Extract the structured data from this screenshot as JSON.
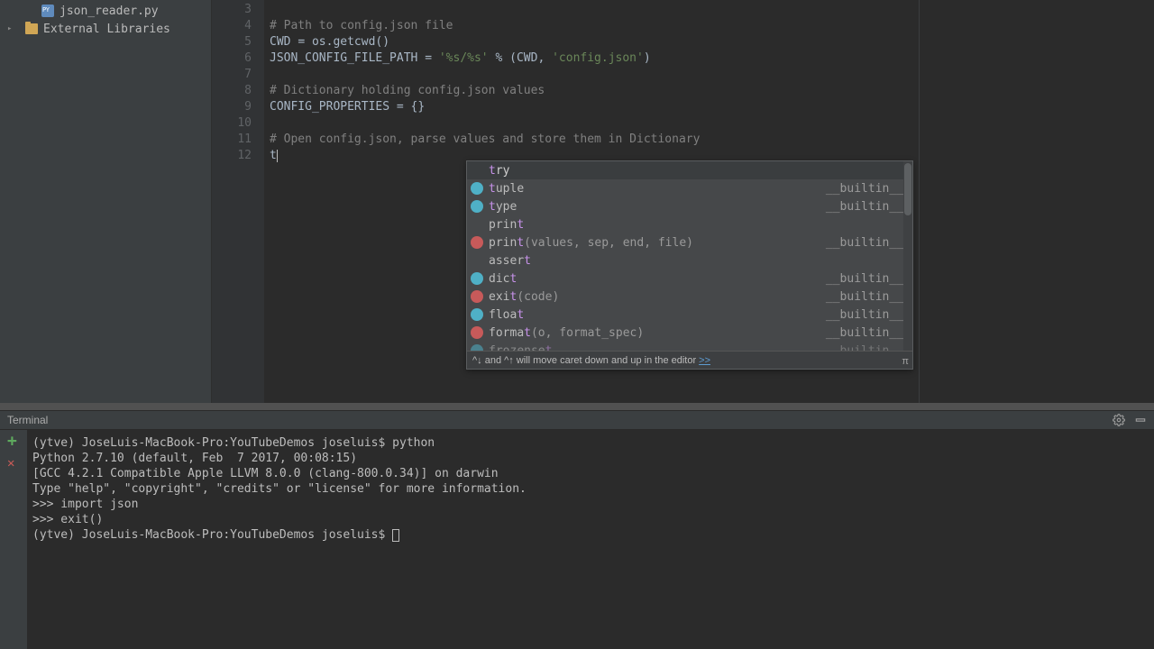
{
  "sidebar": {
    "items": [
      {
        "label": "json_reader.py",
        "kind": "file"
      },
      {
        "label": "External Libraries",
        "kind": "lib"
      }
    ]
  },
  "editor": {
    "lines": [
      {
        "n": 3,
        "text": ""
      },
      {
        "n": 4,
        "text": "# Path to config.json file",
        "cls": "comment"
      },
      {
        "n": 5,
        "segments": [
          {
            "t": "CWD ",
            "c": "var"
          },
          {
            "t": "= ",
            "c": "op"
          },
          {
            "t": "os.getcwd()",
            "c": "var"
          }
        ]
      },
      {
        "n": 6,
        "segments": [
          {
            "t": "JSON_CONFIG_FILE_PATH ",
            "c": "var"
          },
          {
            "t": "= ",
            "c": "op"
          },
          {
            "t": "'%s/%s'",
            "c": "str"
          },
          {
            "t": " % (",
            "c": "var"
          },
          {
            "t": "CWD",
            "c": "var"
          },
          {
            "t": ", ",
            "c": "var"
          },
          {
            "t": "'config.json'",
            "c": "str"
          },
          {
            "t": ")",
            "c": "var"
          }
        ]
      },
      {
        "n": 7,
        "text": ""
      },
      {
        "n": 8,
        "text": "# Dictionary holding config.json values",
        "cls": "comment"
      },
      {
        "n": 9,
        "segments": [
          {
            "t": "CONFIG_PROPERTIES ",
            "c": "var"
          },
          {
            "t": "= {}",
            "c": "var"
          }
        ]
      },
      {
        "n": 10,
        "text": ""
      },
      {
        "n": 11,
        "text": "# Open config.json, parse values and store them in Dictionary",
        "cls": "comment"
      },
      {
        "n": 12,
        "segments": [
          {
            "t": "t",
            "c": "var"
          }
        ],
        "caret": true
      }
    ]
  },
  "autocomplete": {
    "rows": [
      {
        "icon": "",
        "name": "try",
        "match_at": 0,
        "right": "",
        "selected": true
      },
      {
        "icon": "#4fb0c6",
        "name": "tuple",
        "match_at": 0,
        "right": "__builtin__"
      },
      {
        "icon": "#4fb0c6",
        "name": "type",
        "match_at": 0,
        "right": "__builtin__"
      },
      {
        "icon": "",
        "name": "print",
        "match_at": 4,
        "right": ""
      },
      {
        "icon": "#c75a5a",
        "name": "print",
        "params": "(values, sep, end, file)",
        "match_at": 4,
        "right": "__builtin__"
      },
      {
        "icon": "",
        "name": "assert",
        "match_at": 5,
        "right": ""
      },
      {
        "icon": "#4fb0c6",
        "name": "dict",
        "match_at": 3,
        "right": "__builtin__"
      },
      {
        "icon": "#c75a5a",
        "name": "exit",
        "params": "(code)",
        "match_at": 3,
        "right": "__builtin__"
      },
      {
        "icon": "#4fb0c6",
        "name": "float",
        "match_at": 4,
        "right": "__builtin__"
      },
      {
        "icon": "#c75a5a",
        "name": "format",
        "params": "(o, format_spec)",
        "match_at": 5,
        "right": "__builtin__"
      },
      {
        "icon": "#4fb0c6",
        "name": "frozenset",
        "match_at": 8,
        "right": "__builtin__",
        "dim": true
      }
    ],
    "footer_pre": "^↓ and ^↑ ",
    "footer_txt": "will move caret down and up in the editor ",
    "footer_link": ">>"
  },
  "terminal_header": {
    "title": "Terminal",
    "icons": [
      "settings",
      "minimize"
    ]
  },
  "terminal": {
    "lines": [
      "(ytve) JoseLuis-MacBook-Pro:YouTubeDemos joseluis$ python",
      "Python 2.7.10 (default, Feb  7 2017, 00:08:15)",
      "[GCC 4.2.1 Compatible Apple LLVM 8.0.0 (clang-800.0.34)] on darwin",
      "Type \"help\", \"copyright\", \"credits\" or \"license\" for more information.",
      ">>> import json",
      ">>> exit()",
      "(ytve) JoseLuis-MacBook-Pro:YouTubeDemos joseluis$ "
    ]
  }
}
